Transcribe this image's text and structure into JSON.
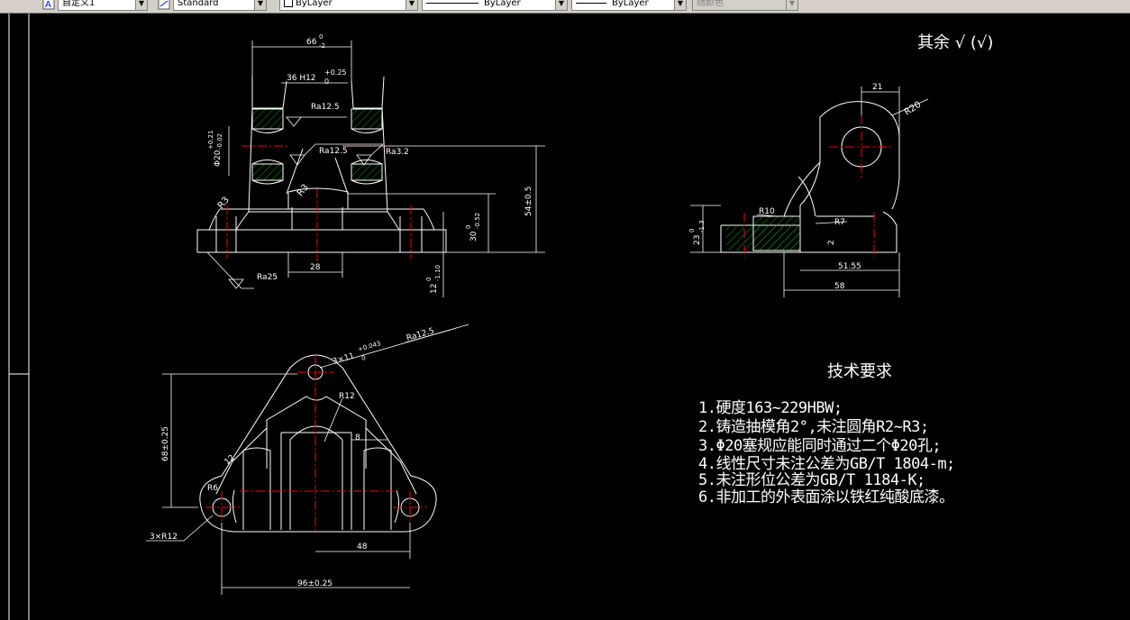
{
  "toolbar": {
    "combos": [
      {
        "value": "自定义1"
      },
      {
        "value": "Standard"
      },
      {
        "value": "ByLayer"
      },
      {
        "value": "ByLayer"
      },
      {
        "value": "ByLayer"
      },
      {
        "value": "随颜色"
      }
    ]
  },
  "drawing": {
    "front_view_dims": {
      "width_66": "66",
      "width_66_upper": "0",
      "width_66_lower": "-2",
      "bore_36": "36 H12",
      "bore_36_upper": "+0.25",
      "bore_36_lower": "0",
      "ra_12_5_a": "Ra12.5",
      "ra_12_5_b": "Ra12.5",
      "ra_3_2": "Ra3.2",
      "phi20": "Φ20",
      "phi20_upper": "+0.21",
      "phi20_lower": "-0.02",
      "r3_a": "R3",
      "r3_b": "R3",
      "height_54": "54±0.5",
      "height_30": "30",
      "height_30_upper": "0",
      "height_30_lower": "-0.52",
      "width_28": "28",
      "ra_25": "Ra25",
      "height_12": "12",
      "height_12_upper": "0",
      "height_12_lower": "-1.10"
    },
    "side_view_dims": {
      "width_21": "21",
      "r20": "R20",
      "r10": "R10",
      "r7": "R7",
      "height_23": "23",
      "height_23_upper": "0",
      "height_23_lower": "-1.3",
      "dim_2": "2",
      "width_51_55": "51.55",
      "width_58": "58"
    },
    "top_view_dims": {
      "holes": "3×11",
      "holes_upper": "+0.043",
      "holes_lower": "0",
      "ra_12_5": "Ra12.5",
      "r12": "R12",
      "height_68": "68±0.25",
      "dim_12": "12",
      "dim_8": "8",
      "r6": "R6",
      "corners": "3×R12",
      "width_48": "48",
      "width_96": "96±0.25"
    },
    "roughness_note": "其余 √ (√)"
  },
  "tech_requirements": {
    "title": "技术要求",
    "items": [
      "1.硬度163~229HBW;",
      "2.铸造抽模角2°,未注圆角R2~R3;",
      "3.Φ20塞规应能同时通过二个Φ20孔;",
      "4.线性尺寸未注公差为GB/T 1804-m;",
      "5.未注形位公差为GB/T 1184-K;",
      "6.非加工的外表面涂以铁红纯酸底漆。"
    ]
  },
  "colors": {
    "background": "#000000",
    "line": "#ffffff",
    "center_line": "#ff0000",
    "hatch": "#00a000"
  }
}
